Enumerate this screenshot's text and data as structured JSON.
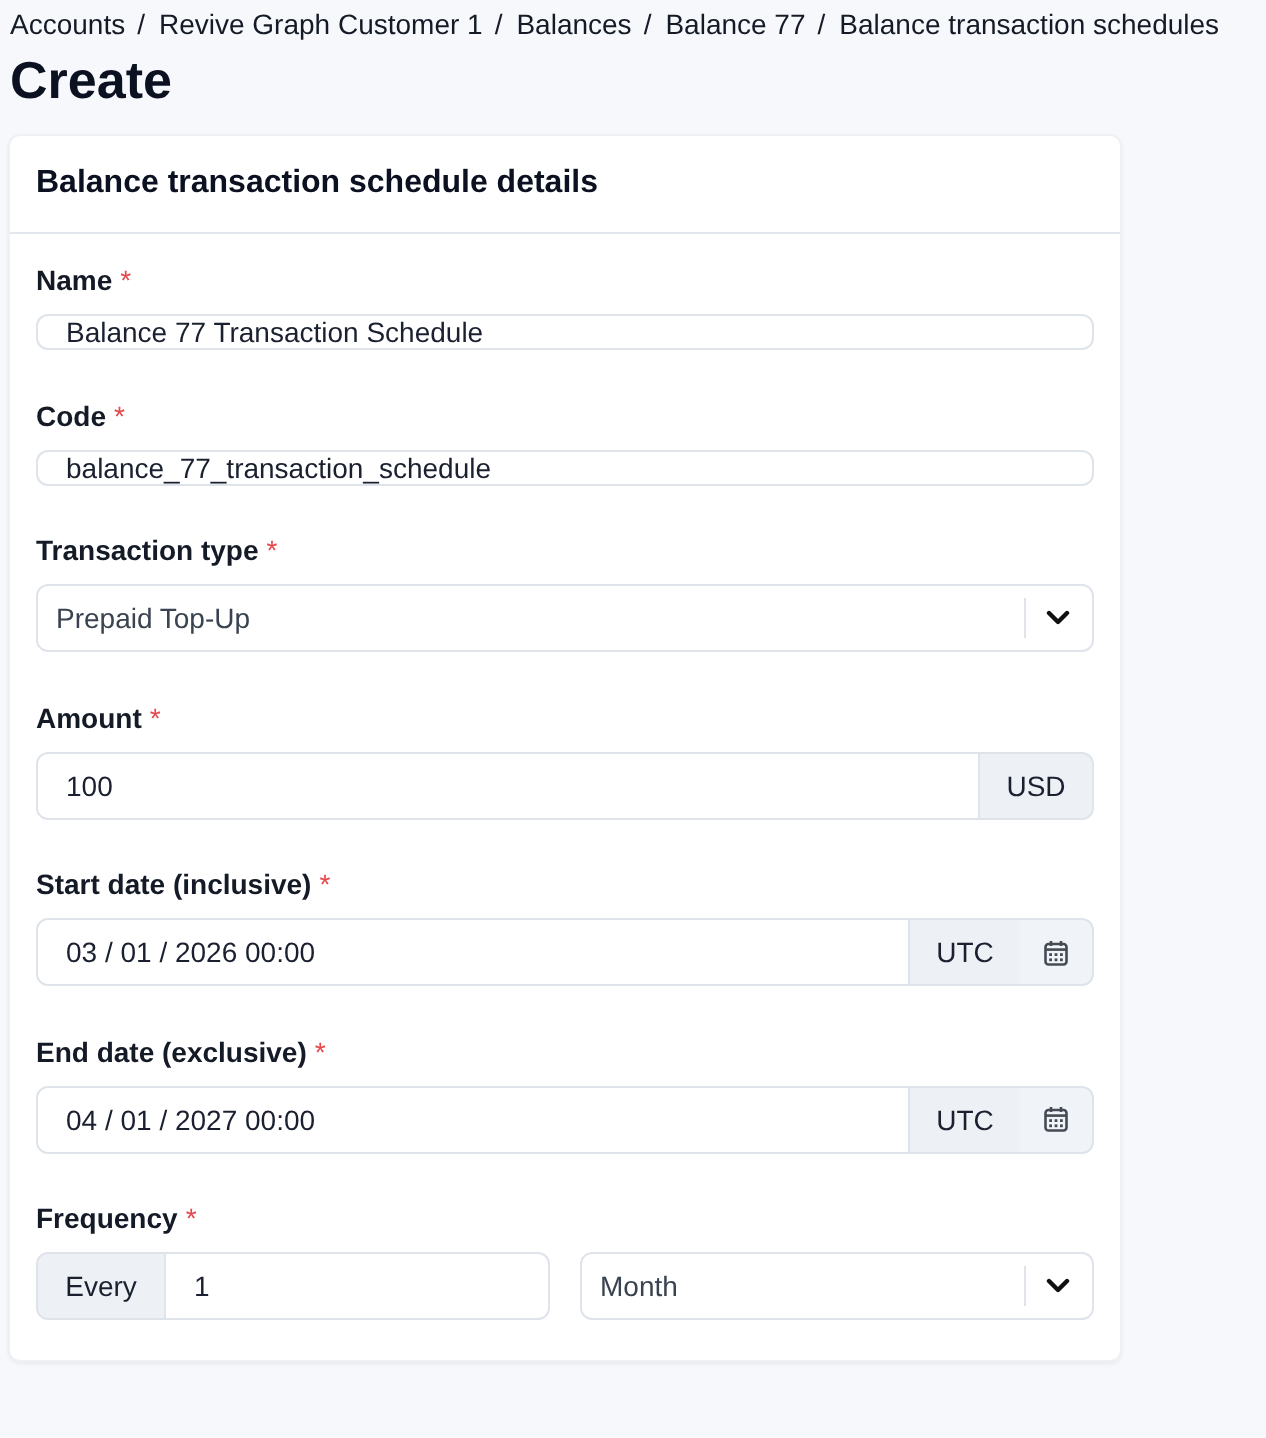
{
  "breadcrumb": {
    "separator": "/",
    "items": [
      "Accounts",
      "Revive Graph Customer 1",
      "Balances",
      "Balance 77",
      "Balance transaction schedules"
    ]
  },
  "page_title": "Create",
  "card": {
    "title": "Balance transaction schedule details",
    "fields": [
      {
        "kind": "text",
        "label": "Name",
        "required_mark": "*",
        "value": "Balance 77 Transaction Schedule"
      },
      {
        "kind": "text",
        "label": "Code",
        "required_mark": "*",
        "value": "balance_77_transaction_schedule"
      },
      {
        "kind": "select",
        "label": "Transaction type",
        "required_mark": "*",
        "value": "Prepaid Top-Up"
      },
      {
        "kind": "amount",
        "label": "Amount",
        "required_mark": "*",
        "value": "100",
        "suffix": "USD"
      },
      {
        "kind": "datetime",
        "label": "Start date (inclusive)",
        "required_mark": "*",
        "value": "03 / 01 / 2026 00:00",
        "suffix": "UTC"
      },
      {
        "kind": "datetime",
        "label": "End date (exclusive)",
        "required_mark": "*",
        "value": "04 / 01 / 2027 00:00",
        "suffix": "UTC"
      },
      {
        "kind": "frequency",
        "label": "Frequency",
        "required_mark": "*",
        "prefix": "Every",
        "value": "1",
        "unit": "Month"
      }
    ]
  }
}
